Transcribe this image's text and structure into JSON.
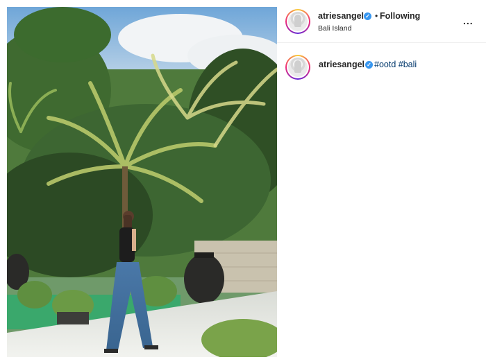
{
  "post": {
    "username": "atriesangel",
    "verified_glyph": "✓",
    "separator": "•",
    "follow_status": "Following",
    "location": "Bali Island",
    "more_label": "...",
    "caption": {
      "username": "atriesangel",
      "hashtags": [
        "#ootd",
        "#bali"
      ]
    },
    "photo_subject": "woman-in-jeans-tropical-garden",
    "colors": {
      "verified": "#3897f0",
      "hashtag": "#00376b",
      "text": "#262626"
    }
  }
}
